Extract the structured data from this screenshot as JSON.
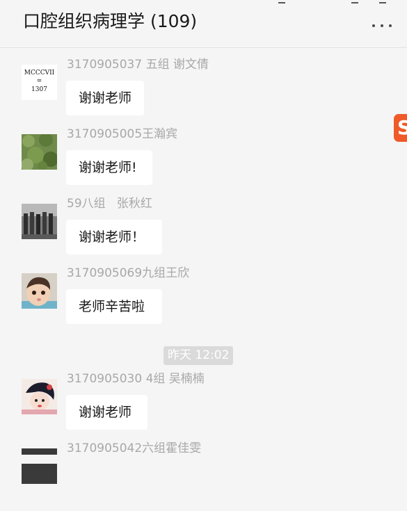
{
  "header": {
    "title": "口腔组织病理学 (109)",
    "more_icon": "more-dots-icon"
  },
  "messages": [
    {
      "sender": "3170905037 五组 谢文倩",
      "text": "谢谢老师",
      "avatar": "MCCCVII\n=\n1307"
    },
    {
      "sender": "3170905005王瀚宾",
      "text": "谢谢老师!"
    },
    {
      "sender": "59八组   张秋红",
      "text": "谢谢老师！"
    },
    {
      "sender": "3170905069九组王欣",
      "text": "老师辛苦啦"
    },
    {
      "sender": "3170905030 4组 吴楠楠",
      "text": "谢谢老师"
    },
    {
      "sender": "3170905042六组霍佳雯"
    }
  ],
  "timestamp": "昨天 12:02",
  "side_badge": {
    "letter": "S",
    "color": "#ef5a28"
  }
}
